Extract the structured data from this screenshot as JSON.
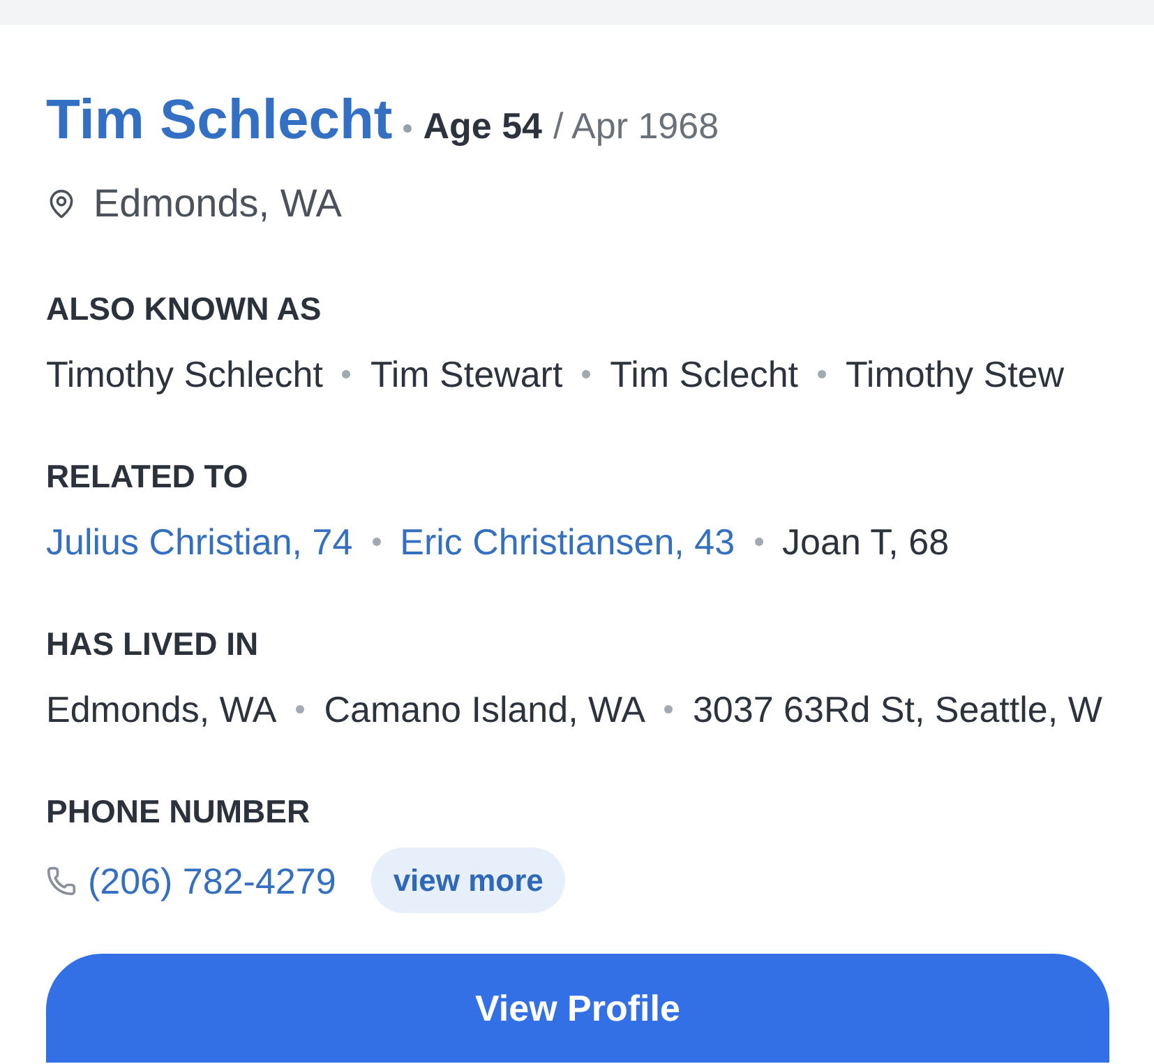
{
  "person": {
    "name": "Tim Schlecht",
    "age": "Age 54",
    "birth": "/ Apr 1968",
    "location": "Edmonds, WA"
  },
  "sections": [
    {
      "kind": "aliases",
      "heading": "ALSO KNOWN AS",
      "items": [
        {
          "text": "Timothy Schlecht"
        },
        {
          "text": "Tim Stewart"
        },
        {
          "text": "Tim Sclecht"
        },
        {
          "text": "Timothy Stew"
        }
      ]
    },
    {
      "kind": "relatives",
      "heading": "RELATED TO",
      "items": [
        {
          "text": "Julius Christian, 74",
          "link": true
        },
        {
          "text": "Eric Christiansen, 43",
          "link": true
        },
        {
          "text": "Joan T, 68",
          "link": false
        }
      ]
    },
    {
      "kind": "places",
      "heading": "HAS LIVED IN",
      "items": [
        {
          "text": "Edmonds, WA"
        },
        {
          "text": "Camano Island, WA"
        },
        {
          "text": "3037 63Rd St, Seattle, W"
        }
      ]
    },
    {
      "kind": "phone",
      "heading": "PHONE NUMBER",
      "number": "(206) 782-4279",
      "more": "view more"
    }
  ],
  "button": "View Profile"
}
